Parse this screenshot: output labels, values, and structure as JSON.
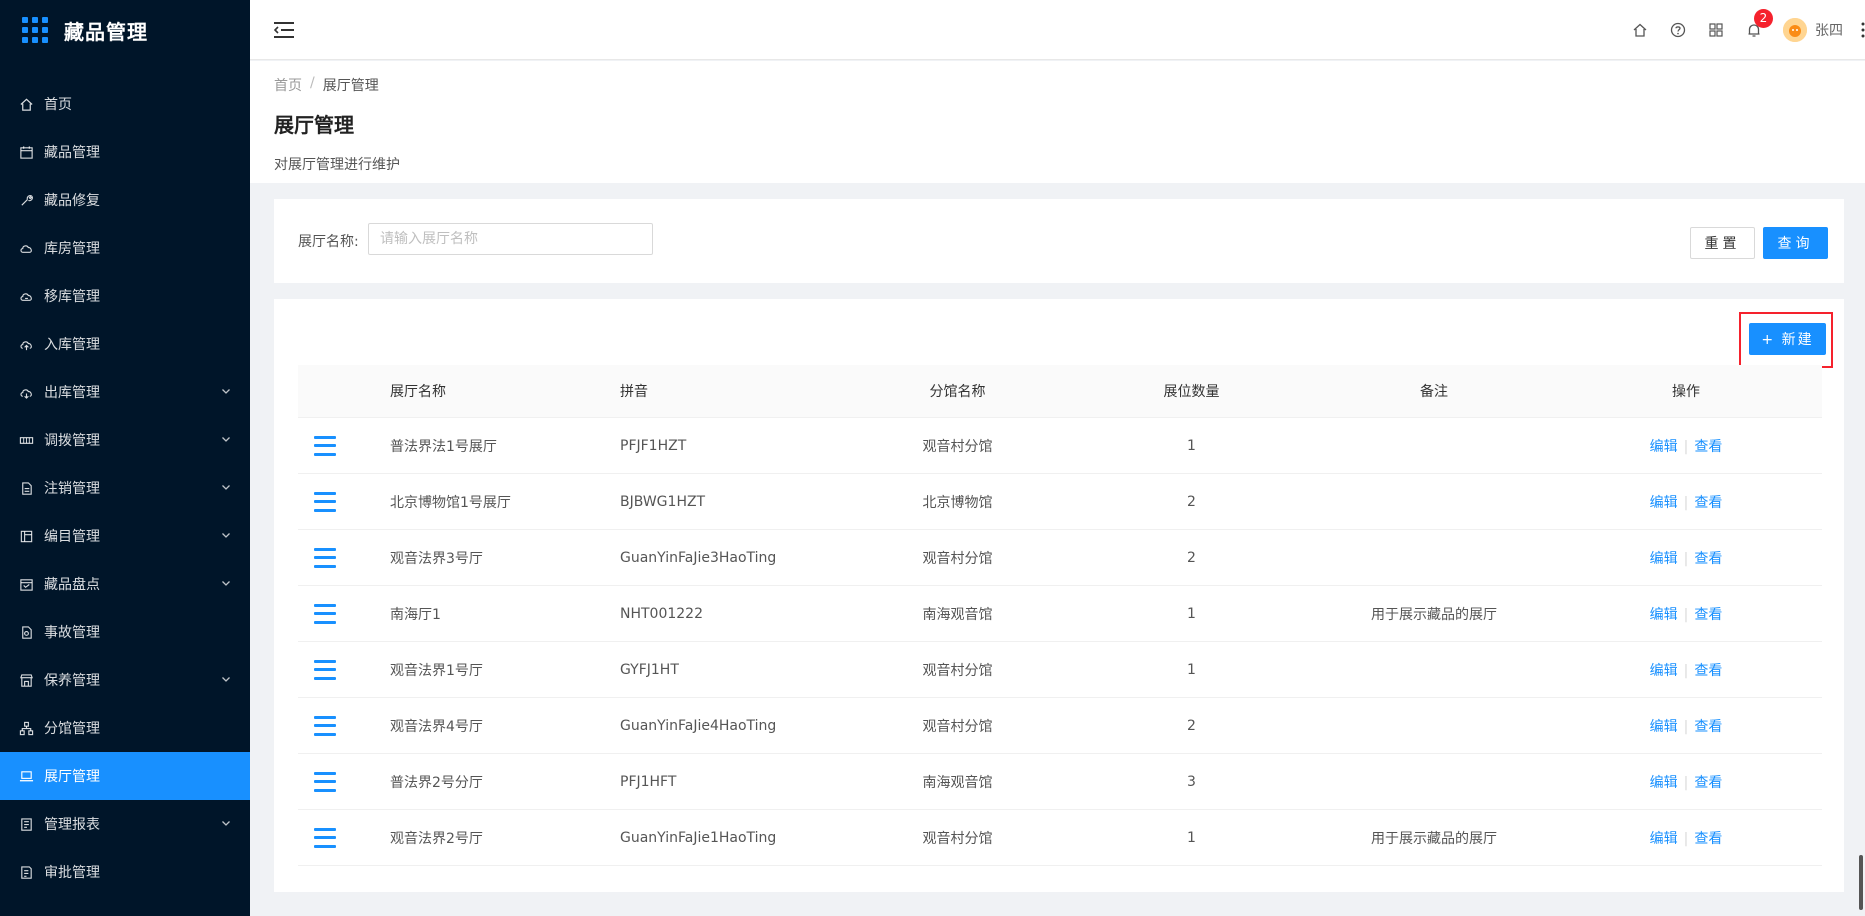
{
  "app": {
    "title": "藏品管理"
  },
  "sidebar": {
    "items": [
      {
        "label": "首页",
        "icon": "home-icon",
        "has_children": false
      },
      {
        "label": "藏品管理",
        "icon": "calendar-icon",
        "has_children": false
      },
      {
        "label": "藏品修复",
        "icon": "wrench-icon",
        "has_children": false
      },
      {
        "label": "库房管理",
        "icon": "cloud-icon",
        "has_children": false
      },
      {
        "label": "移库管理",
        "icon": "cloud-sync-icon",
        "has_children": false
      },
      {
        "label": "入库管理",
        "icon": "cloud-upload-icon",
        "has_children": false
      },
      {
        "label": "出库管理",
        "icon": "cloud-download-icon",
        "has_children": true
      },
      {
        "label": "调拨管理",
        "icon": "swap-icon",
        "has_children": true
      },
      {
        "label": "注销管理",
        "icon": "file-icon",
        "has_children": true
      },
      {
        "label": "编目管理",
        "icon": "catalog-icon",
        "has_children": true
      },
      {
        "label": "藏品盘点",
        "icon": "schedule-icon",
        "has_children": true
      },
      {
        "label": "事故管理",
        "icon": "file-search-icon",
        "has_children": false
      },
      {
        "label": "保养管理",
        "icon": "shop-icon",
        "has_children": true
      },
      {
        "label": "分馆管理",
        "icon": "cluster-icon",
        "has_children": false
      },
      {
        "label": "展厅管理",
        "icon": "laptop-icon",
        "has_children": false,
        "active": true
      },
      {
        "label": "管理报表",
        "icon": "report-icon",
        "has_children": true
      },
      {
        "label": "审批管理",
        "icon": "audit-icon",
        "has_children": false
      }
    ]
  },
  "header": {
    "notification_count": "2",
    "user_name": "张四"
  },
  "page": {
    "breadcrumb": [
      "首页",
      "展厅管理"
    ],
    "breadcrumb_separator": "/",
    "title": "展厅管理",
    "description": "对展厅管理进行维护"
  },
  "filter": {
    "label": "展厅名称:",
    "placeholder": "请输入展厅名称",
    "reset_label": "重置",
    "search_label": "查询"
  },
  "table": {
    "new_label": "+ 新建",
    "columns": [
      "",
      "展厅名称",
      "拼音",
      "分馆名称",
      "展位数量",
      "备注",
      "操作"
    ],
    "edit_label": "编辑",
    "view_label": "查看",
    "rows": [
      {
        "name": "普法界法1号展厅",
        "pinyin": "PFJF1HZT",
        "branch": "观音村分馆",
        "count": "1",
        "remark": ""
      },
      {
        "name": "北京博物馆1号展厅",
        "pinyin": "BJBWG1HZT",
        "branch": "北京博物馆",
        "count": "2",
        "remark": ""
      },
      {
        "name": "观音法界3号厅",
        "pinyin": "GuanYinFaJie3HaoTing",
        "branch": "观音村分馆",
        "count": "2",
        "remark": ""
      },
      {
        "name": "南海厅1",
        "pinyin": "NHT001222",
        "branch": "南海观音馆",
        "count": "1",
        "remark": "用于展示藏品的展厅"
      },
      {
        "name": "观音法界1号厅",
        "pinyin": "GYFJ1HT",
        "branch": "观音村分馆",
        "count": "1",
        "remark": ""
      },
      {
        "name": "观音法界4号厅",
        "pinyin": "GuanYinFaJie4HaoTing",
        "branch": "观音村分馆",
        "count": "2",
        "remark": ""
      },
      {
        "name": "普法界2号分厅",
        "pinyin": "PFJ1HFT",
        "branch": "南海观音馆",
        "count": "3",
        "remark": ""
      },
      {
        "name": "观音法界2号厅",
        "pinyin": "GuanYinFaJie1HaoTing",
        "branch": "观音村分馆",
        "count": "1",
        "remark": "用于展示藏品的展厅"
      }
    ]
  },
  "colors": {
    "primary": "#1890ff",
    "sidebar_bg": "#001529",
    "danger": "#f5222d"
  }
}
